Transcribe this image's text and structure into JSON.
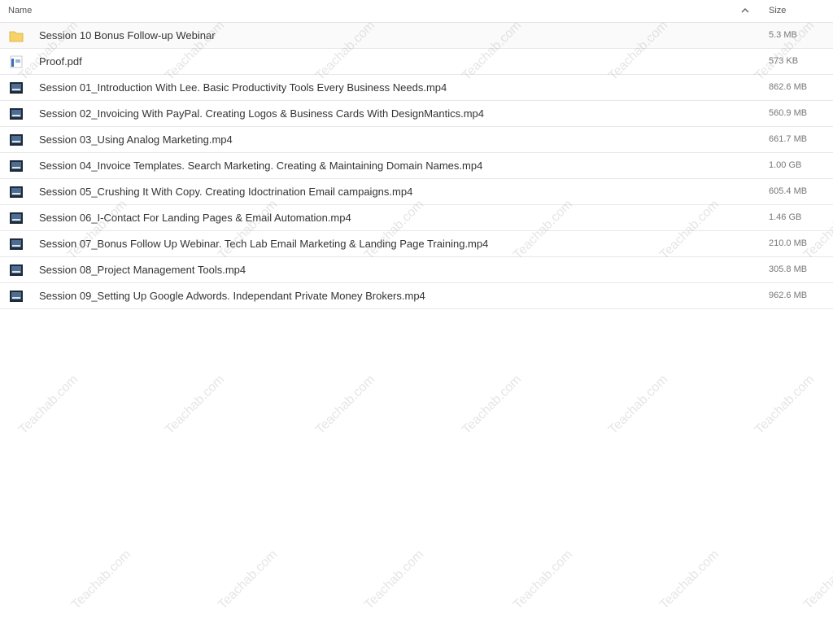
{
  "header": {
    "name_label": "Name",
    "size_label": "Size",
    "sort_icon": "chevron-up-icon"
  },
  "files": [
    {
      "icon": "folder-icon",
      "name": "Session 10 Bonus Follow-up Webinar",
      "size": "5.3 MB"
    },
    {
      "icon": "pdf-icon",
      "name": "Proof.pdf",
      "size": "573 KB"
    },
    {
      "icon": "video-thumbnail-icon",
      "name": "Session 01_Introduction With Lee. Basic Productivity Tools Every Business Needs.mp4",
      "size": "862.6 MB"
    },
    {
      "icon": "video-thumbnail-icon",
      "name": "Session 02_Invoicing With PayPal. Creating Logos & Business Cards With DesignMantics.mp4",
      "size": "560.9 MB"
    },
    {
      "icon": "video-thumbnail-icon",
      "name": "Session 03_Using Analog Marketing.mp4",
      "size": "661.7 MB"
    },
    {
      "icon": "video-thumbnail-icon",
      "name": "Session 04_Invoice Templates. Search Marketing. Creating & Maintaining Domain Names.mp4",
      "size": "1.00 GB"
    },
    {
      "icon": "video-thumbnail-icon",
      "name": "Session 05_Crushing It With Copy. Creating Idoctrination Email campaigns.mp4",
      "size": "605.4 MB"
    },
    {
      "icon": "video-thumbnail-icon",
      "name": "Session 06_I-Contact For Landing Pages & Email Automation.mp4",
      "size": "1.46 GB"
    },
    {
      "icon": "video-thumbnail-icon",
      "name": "Session 07_Bonus Follow Up Webinar. Tech Lab Email Marketing & Landing Page Training.mp4",
      "size": "210.0 MB"
    },
    {
      "icon": "video-thumbnail-icon",
      "name": "Session 08_Project Management Tools.mp4",
      "size": "305.8 MB"
    },
    {
      "icon": "video-thumbnail-icon",
      "name": "Session 09_Setting Up Google Adwords. Independant Private Money Brokers.mp4",
      "size": "962.6 MB"
    }
  ],
  "watermark": "Teachab.com",
  "colors": {
    "folder": "#f5c94a",
    "row_border": "#e8e8e8",
    "text": "#333333",
    "size_text": "#777777"
  }
}
